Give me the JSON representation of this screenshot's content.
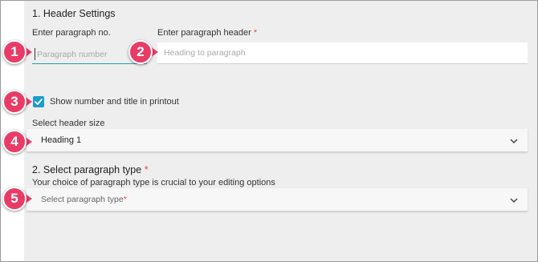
{
  "header_settings": {
    "title": "1. Header Settings",
    "paragraph_no_label": "Enter paragraph no.",
    "paragraph_no_placeholder": "Paragraph number",
    "paragraph_header_label": "Enter paragraph header",
    "required_mark": "*",
    "paragraph_header_placeholder": "Heading to paragraph",
    "show_in_printout_label": "Show number and title in printout",
    "show_in_printout_checked": true,
    "header_size_label": "Select header size",
    "header_size_value": "Heading 1"
  },
  "paragraph_type": {
    "title": "2. Select paragraph type",
    "required_mark": "*",
    "description": "Your choice of paragraph type is crucial to your editing options",
    "placeholder": "Select paragraph type",
    "placeholder_required_mark": "*"
  },
  "callouts": [
    "1",
    "2",
    "3",
    "4",
    "5"
  ],
  "colors": {
    "callout": "#e83c67",
    "accent": "#1e9cc8",
    "required": "#e5484d",
    "panel_bg": "#eeeeee"
  },
  "icons": {
    "checkbox_check": "check-icon",
    "dropdown": "chevron-down-icon"
  }
}
